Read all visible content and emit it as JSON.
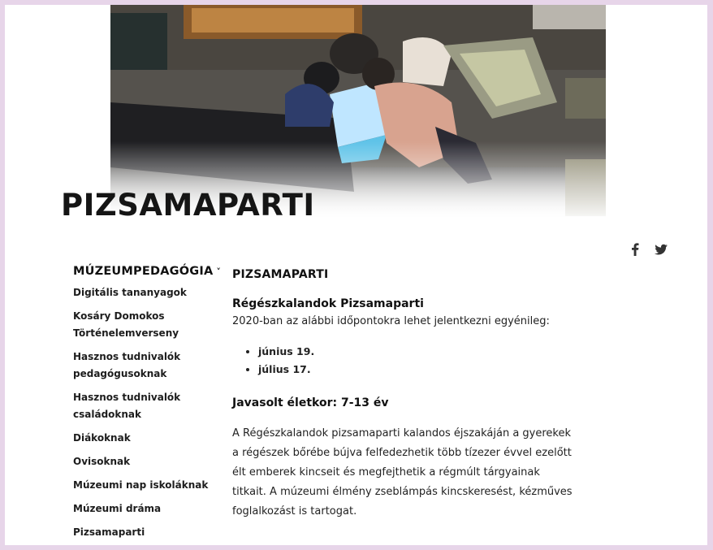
{
  "hero": {
    "image_description": "museum-interior-children-exploring-lit-table"
  },
  "page": {
    "title": "PIZSAMAPARTI"
  },
  "social": {
    "facebook_icon": "facebook-icon",
    "twitter_icon": "twitter-icon"
  },
  "sidebar": {
    "heading": "MÚZEUMPEDAGÓGIA",
    "chevron": "˅",
    "items": [
      "Digitális tananyagok",
      "Kosáry Domokos Történelemverseny",
      "Hasznos tudnivalók pedagógusoknak",
      "Hasznos tudnivalók családoknak",
      "Diákoknak",
      "Ovisoknak",
      "Múzeumi nap iskoláknak",
      "Múzeumi dráma",
      "Pizsamaparti"
    ]
  },
  "content": {
    "heading": "PIZSAMAPARTI",
    "subheading": "Régészkalandok Pizsamaparti",
    "intro": "2020-ban az alábbi időpontokra lehet jelentkezni egyénileg:",
    "dates": [
      "június 19.",
      "július 17."
    ],
    "age": "Javasolt életkor: 7-13 év",
    "description": "A Régészkalandok pizsamaparti kalandos éjszakáján a gyerekek a régészek bőrébe bújva felfedezhetik több tízezer évvel ezelőtt élt emberek kincseit és megfejthetik a régmúlt tárgyainak titkait. A múzeumi élmény zseblámpás kincskeresést, kézműves foglalkozást is tartogat."
  }
}
